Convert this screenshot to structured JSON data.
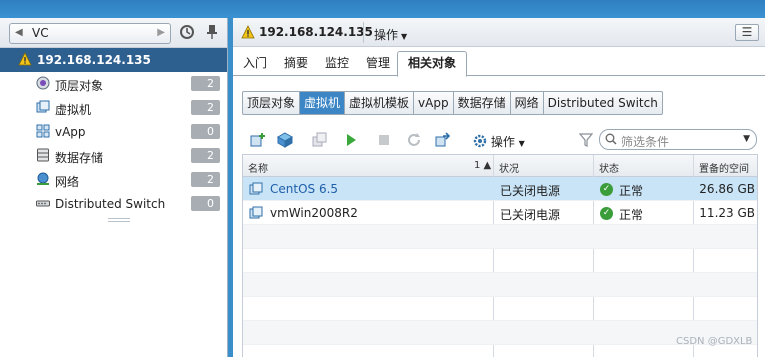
{
  "navigator": {
    "back_label": "VC",
    "host_name": "192.168.124.135",
    "items": [
      {
        "label": "顶层对象",
        "count": "2",
        "icon": "top-objects-icon"
      },
      {
        "label": "虚拟机",
        "count": "2",
        "icon": "vm-icon"
      },
      {
        "label": "vApp",
        "count": "0",
        "icon": "vapp-icon"
      },
      {
        "label": "数据存储",
        "count": "2",
        "icon": "datastore-icon"
      },
      {
        "label": "网络",
        "count": "2",
        "icon": "network-icon"
      },
      {
        "label": "Distributed Switch",
        "count": "0",
        "icon": "distributed-switch-icon"
      }
    ]
  },
  "header": {
    "title": "192.168.124.135",
    "actions_label": "操作"
  },
  "tabs": [
    "入门",
    "摘要",
    "监控",
    "管理",
    "相关对象"
  ],
  "active_tab": "相关对象",
  "subtabs": [
    "顶层对象",
    "虚拟机",
    "虚拟机模板",
    "vApp",
    "数据存储",
    "网络",
    "Distributed Switch"
  ],
  "active_subtab": "虚拟机",
  "toolbar": {
    "actions_label": "操作",
    "filter_placeholder": "筛选条件"
  },
  "grid": {
    "columns": [
      "名称",
      "状况",
      "状态",
      "置备的空间"
    ],
    "sort_indicator": "1 ▲",
    "rows": [
      {
        "name": "CentOS 6.5",
        "state": "已关闭电源",
        "status": "正常",
        "space": "26.86  GB",
        "selected": true
      },
      {
        "name": "vmWin2008R2",
        "state": "已关闭电源",
        "status": "正常",
        "space": "11.23  GB",
        "selected": false
      }
    ]
  },
  "watermark": "CSDN @GDXLB",
  "colors": {
    "host_row_bg": "#2d5f8f",
    "selected_row": "#c9e4f7",
    "subtab_selected": "#3d86c6",
    "ok_green": "#3a9d3a"
  }
}
